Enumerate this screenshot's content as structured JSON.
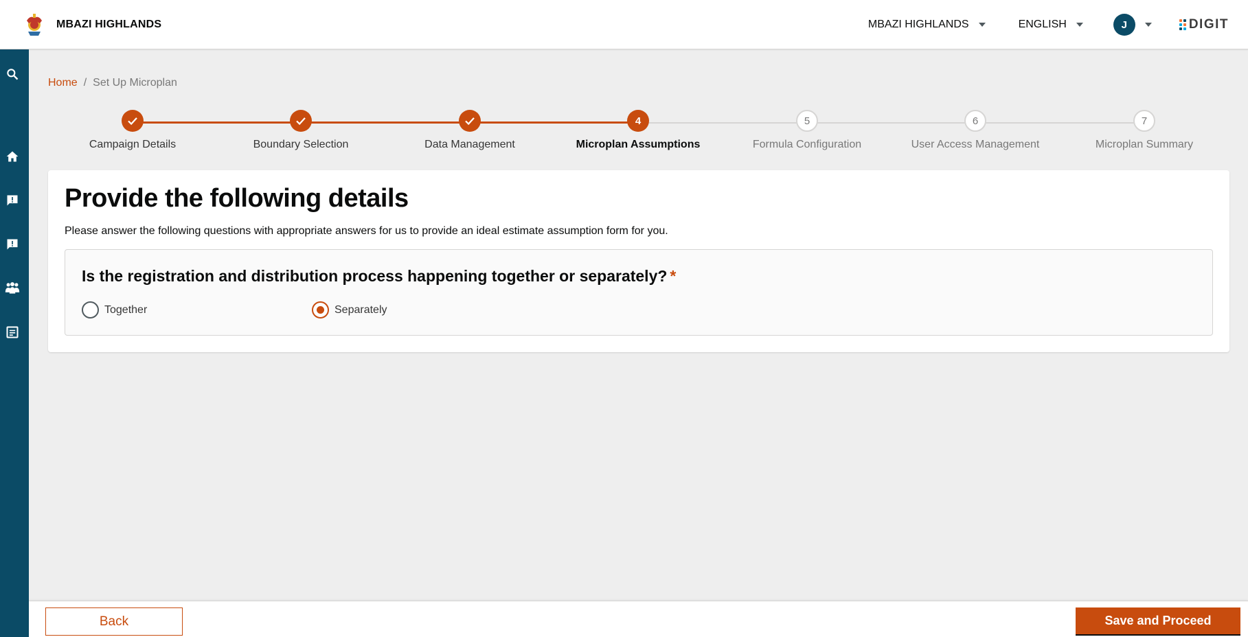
{
  "header": {
    "brand_name": "MBAZI HIGHLANDS",
    "city_selector": "MBAZI HIGHLANDS",
    "language_selector": "ENGLISH",
    "user_initial": "J",
    "logo_text": "DIGIT"
  },
  "sidebar": {
    "items": [
      {
        "icon": "search-icon"
      },
      {
        "icon": "home-icon"
      },
      {
        "icon": "feedback-icon"
      },
      {
        "icon": "feedback-icon"
      },
      {
        "icon": "people-icon"
      },
      {
        "icon": "document-icon"
      }
    ]
  },
  "breadcrumb": {
    "home": "Home",
    "separator": "/",
    "current": "Set Up Microplan"
  },
  "stepper": {
    "steps": [
      {
        "number": "1",
        "label": "Campaign Details",
        "status": "done"
      },
      {
        "number": "2",
        "label": "Boundary Selection",
        "status": "done"
      },
      {
        "number": "3",
        "label": "Data Management",
        "status": "done"
      },
      {
        "number": "4",
        "label": "Microplan Assumptions",
        "status": "active"
      },
      {
        "number": "5",
        "label": "Formula Configuration",
        "status": "pending"
      },
      {
        "number": "6",
        "label": "User Access Management",
        "status": "pending"
      },
      {
        "number": "7",
        "label": "Microplan Summary",
        "status": "pending"
      }
    ]
  },
  "main": {
    "title": "Provide the following details",
    "description": "Please answer the following questions with appropriate answers for us to provide an ideal estimate assumption form for you.",
    "question": {
      "text": "Is the registration and distribution process happening together or separately?",
      "required_mark": "*",
      "options": [
        {
          "label": "Together",
          "selected": false
        },
        {
          "label": "Separately",
          "selected": true
        }
      ]
    }
  },
  "footer": {
    "back_label": "Back",
    "save_label": "Save and Proceed"
  },
  "colors": {
    "primary": "#c84c0e",
    "sidebar": "#0b4b66",
    "background": "#eeeeee",
    "pending": "#d6d5d4"
  }
}
